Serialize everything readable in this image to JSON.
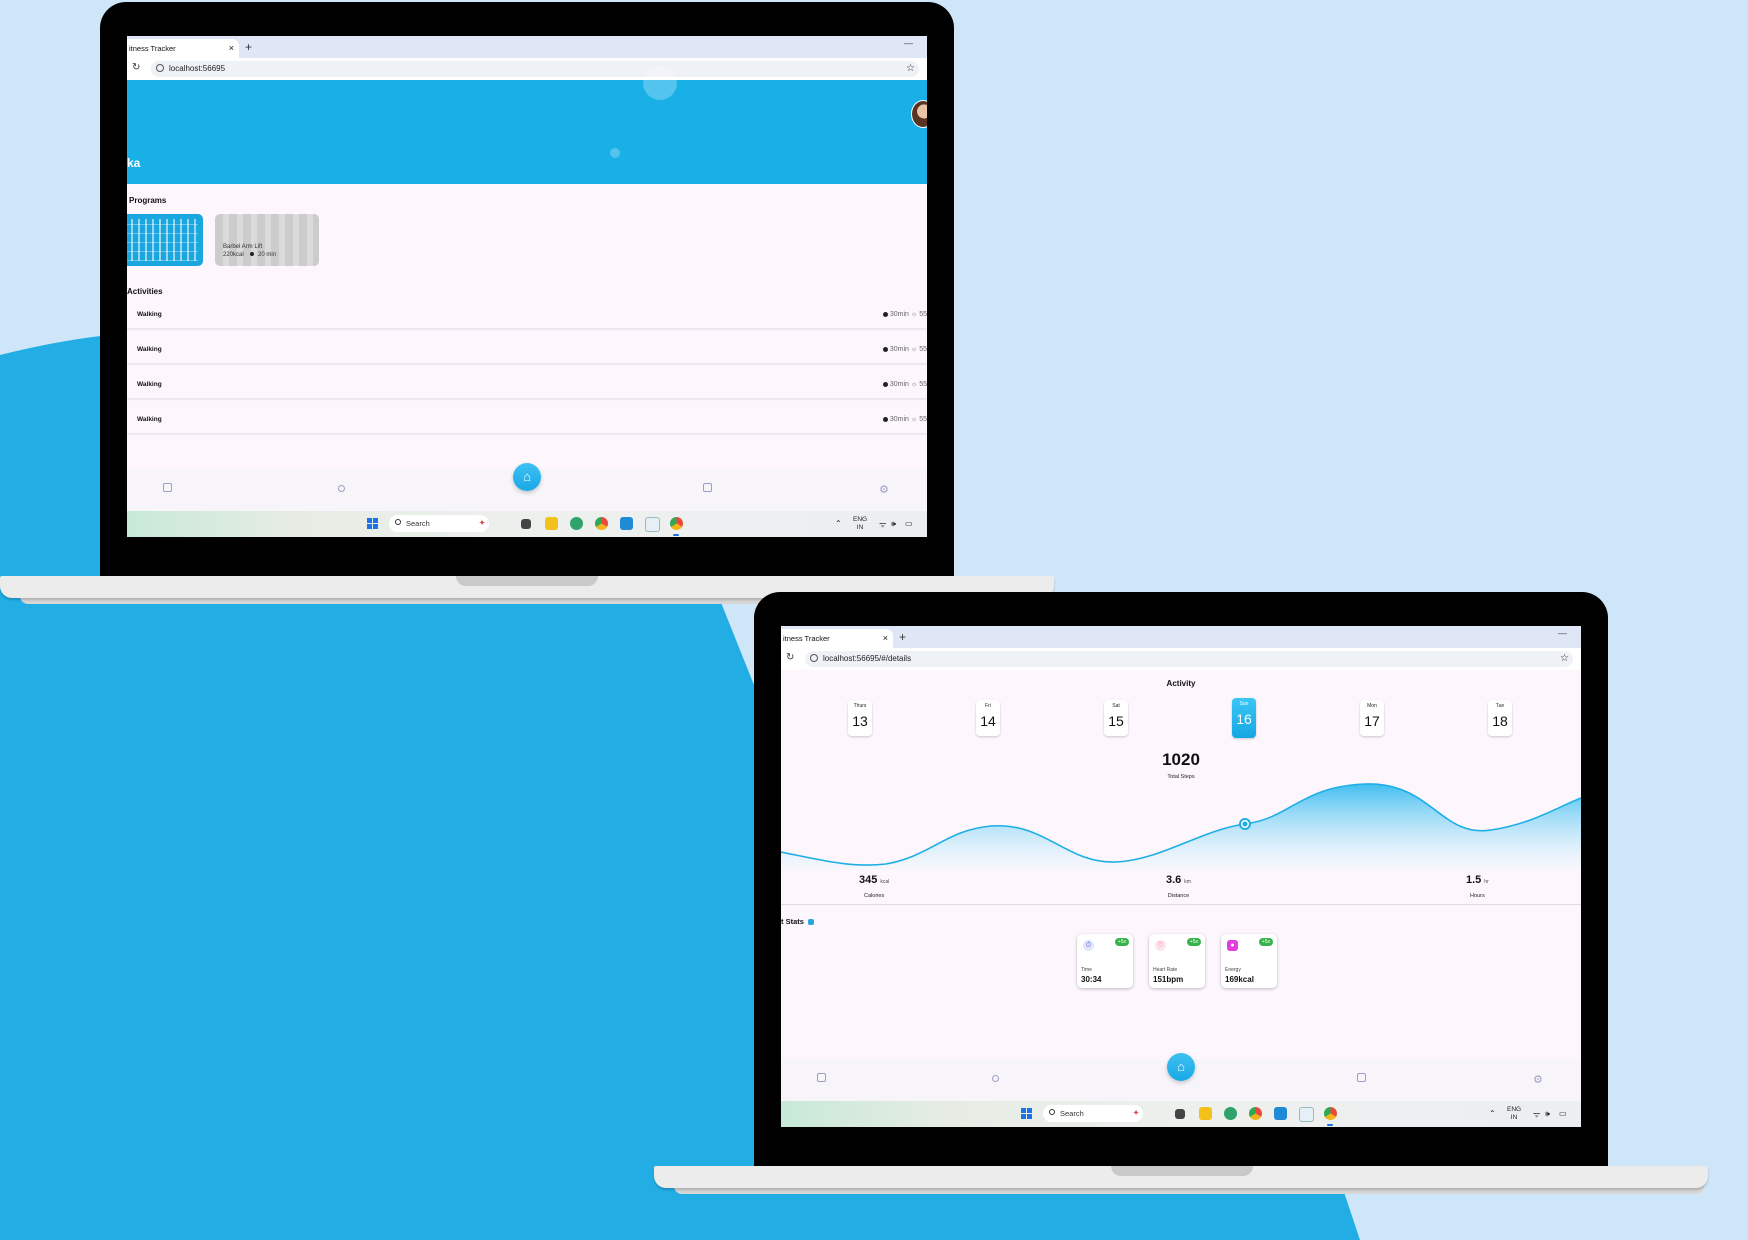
{
  "screen1": {
    "tab_title": "itness Tracker",
    "tab_close": "×",
    "new_tab": "+",
    "window_min": "—",
    "reload": "↻",
    "url": "localhost:56695",
    "star": "☆",
    "hero_name": "ka",
    "programs_title": "Programs",
    "programs": [
      {
        "title": "",
        "meta": ""
      },
      {
        "title": "Barbel Arm Lift",
        "kcal": "220kcal",
        "duration": "20 min"
      }
    ],
    "activities_title": "Activities",
    "activities": [
      {
        "name": "Walking",
        "meta": "30min  ☼ 55"
      },
      {
        "name": "Walking",
        "meta": "30min  ☼ 55"
      },
      {
        "name": "Walking",
        "meta": "30min  ☼ 55"
      },
      {
        "name": "Walking",
        "meta": "30min  ☼ 55"
      }
    ]
  },
  "screen2": {
    "tab_title": "itness Tracker",
    "tab_close": "×",
    "new_tab": "+",
    "window_min": "—",
    "reload": "↻",
    "url": "localhost:56695/#/details",
    "star": "☆",
    "activity_title": "Activity",
    "days": [
      {
        "name": "Thurs",
        "date": "13"
      },
      {
        "name": "Fri",
        "date": "14"
      },
      {
        "name": "Sat",
        "date": "15"
      },
      {
        "name": "Sun",
        "date": "16",
        "active": true
      },
      {
        "name": "Mon",
        "date": "17"
      },
      {
        "name": "Tue",
        "date": "18"
      }
    ],
    "total_steps": "1020",
    "total_steps_label": "Total Steps",
    "stats": [
      {
        "value": "345",
        "unit": "kcal",
        "label": "Calories"
      },
      {
        "value": "3.6",
        "unit": "km",
        "label": "Distance"
      },
      {
        "value": "1.5",
        "unit": "hr",
        "label": "Hours"
      }
    ],
    "stats_title": "t Stats",
    "stat_cards": [
      {
        "label": "Time",
        "value": "30:34",
        "badge": "+5s",
        "icon": "stopwatch-icon",
        "icon_color": "#5b6bd6"
      },
      {
        "label": "Heart Rate",
        "value": "151bpm",
        "badge": "+5s",
        "icon": "heart-icon",
        "icon_color": "#e0468b"
      },
      {
        "label": "Energy",
        "value": "169kcal",
        "badge": "+5s",
        "icon": "energy-icon",
        "icon_color": "#e03ee0"
      }
    ]
  },
  "taskbar": {
    "search_label": "Search",
    "lang": "ENG",
    "region": "IN",
    "tray_icons": "⌃ ᯤ 🕪 ▭"
  },
  "nav": {
    "items": [
      "stats-icon",
      "search-icon",
      "home-icon",
      "calendar-icon",
      "settings-icon"
    ]
  },
  "colors": {
    "accent": "#19b0e8",
    "background": "#cfe5f8",
    "page_bg": "#fdf7fd",
    "badge_green": "#37b34a"
  }
}
